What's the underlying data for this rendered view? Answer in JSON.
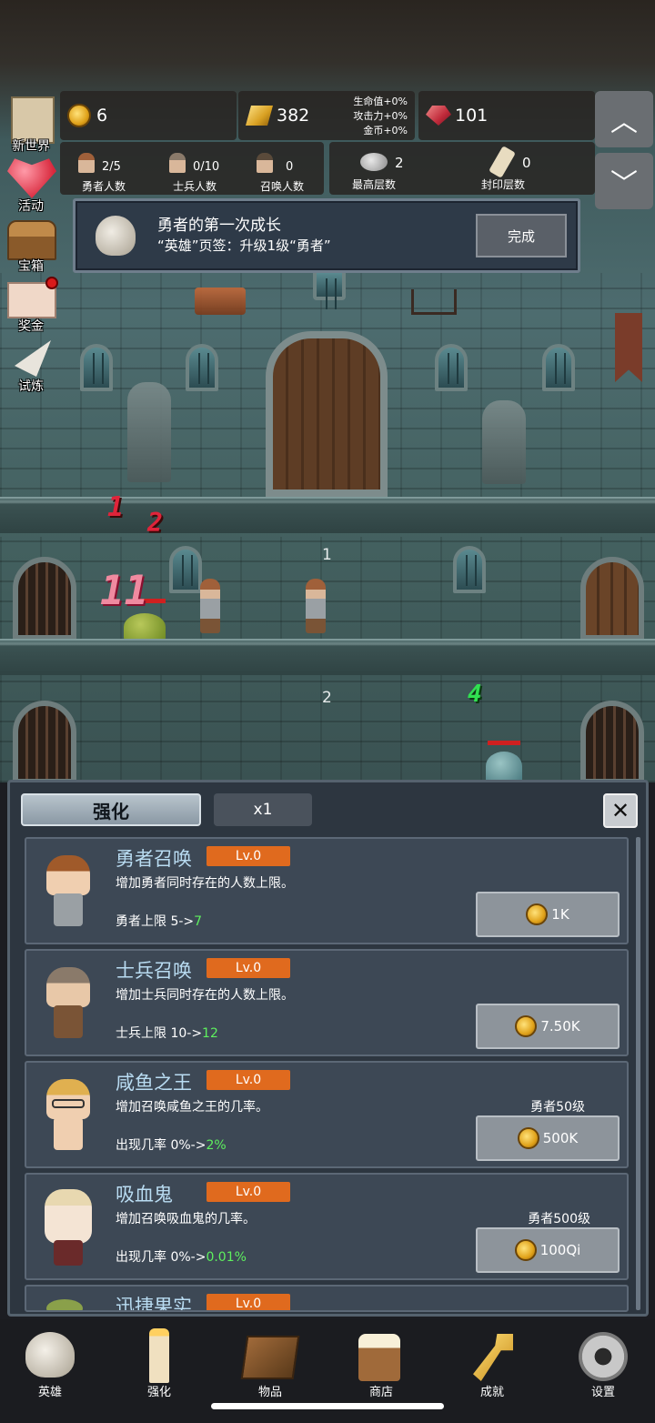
{
  "hud": {
    "gold": "6",
    "bars": "382",
    "buffs": [
      "生命值+0%",
      "攻击力+0%",
      "金币+0%"
    ],
    "gems": "101",
    "heroes": {
      "value": "2/5",
      "label": "勇者人数"
    },
    "soldiers": {
      "value": "0/10",
      "label": "士兵人数"
    },
    "summons": {
      "value": "0",
      "label": "召唤人数"
    },
    "max_floor": {
      "value": "2",
      "label": "最高层数"
    },
    "sealed_floor": {
      "value": "0",
      "label": "封印层数"
    }
  },
  "side_menu": [
    "新世界",
    "活动",
    "宝箱",
    "奖金",
    "试炼"
  ],
  "quest": {
    "title": "勇者的第一次成长",
    "desc": "“英雄”页签：升级1级“勇者”",
    "button": "完成"
  },
  "scene": {
    "floor_labels": [
      "1",
      "2"
    ],
    "damage_numbers": [
      "1",
      "2",
      "11",
      "4"
    ]
  },
  "panel": {
    "tab_active": "强化",
    "multiplier": "x1",
    "close": "✕",
    "cards": [
      {
        "name": "勇者召唤",
        "lv": "Lv.0",
        "desc": "增加勇者同时存在的人数上限。",
        "eff_prefix": "勇者上限 5->",
        "eff_new": "7",
        "req": "",
        "price": "1K"
      },
      {
        "name": "士兵召唤",
        "lv": "Lv.0",
        "desc": "增加士兵同时存在的人数上限。",
        "eff_prefix": "士兵上限 10->",
        "eff_new": "12",
        "req": "",
        "price": "7.50K"
      },
      {
        "name": "咸鱼之王",
        "lv": "Lv.0",
        "desc": "增加召唤咸鱼之王的几率。",
        "eff_prefix": "出现几率 0%->",
        "eff_new": "2%",
        "req": "勇者50级",
        "price": "500K"
      },
      {
        "name": "吸血鬼",
        "lv": "Lv.0",
        "desc": "增加召唤吸血鬼的几率。",
        "eff_prefix": "出现几率 0%->",
        "eff_new": "0.01%",
        "req": "勇者500级",
        "price": "100Qi"
      },
      {
        "name": "迅捷果实",
        "lv": "Lv.0"
      }
    ]
  },
  "nav": [
    "英雄",
    "强化",
    "物品",
    "商店",
    "成就",
    "设置"
  ]
}
